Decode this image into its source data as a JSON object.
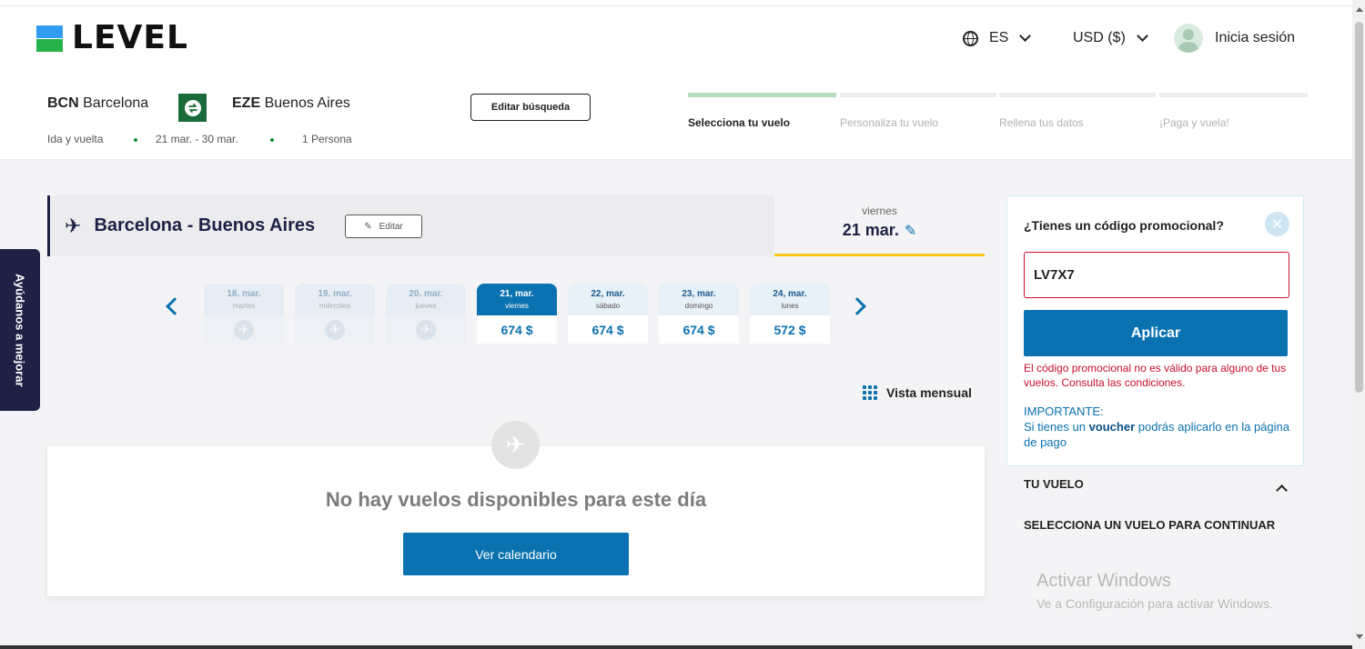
{
  "header": {
    "logo_text": "LEVEL",
    "language": "ES",
    "currency": "USD ($)",
    "login": "Inicia sesión"
  },
  "search": {
    "origin_code": "BCN",
    "origin_city": "Barcelona",
    "destination_code": "EZE",
    "destination_city": "Buenos Aires",
    "trip_type": "Ida y vuelta",
    "dates": "21 mar. - 30 mar.",
    "passengers": "1 Persona",
    "edit_label": "Editar búsqueda"
  },
  "steps": [
    {
      "label": "Selecciona tu vuelo",
      "active": true
    },
    {
      "label": "Personaliza tu vuelo",
      "active": false
    },
    {
      "label": "Rellena tus datos",
      "active": false
    },
    {
      "label": "¡Paga y vuela!",
      "active": false
    }
  ],
  "feedback_tab": "Ayúdanos a mejorar",
  "flight": {
    "title": "Barcelona - Buenos Aires",
    "edit": "Editar",
    "selected_weekday": "viernes",
    "selected_date": "21 mar."
  },
  "days": [
    {
      "date": "18. mar.",
      "weekday": "martes",
      "price": "",
      "state": "disabled"
    },
    {
      "date": "19. mar.",
      "weekday": "miércoles",
      "price": "",
      "state": "disabled"
    },
    {
      "date": "20. mar.",
      "weekday": "jueves",
      "price": "",
      "state": "disabled"
    },
    {
      "date": "21, mar.",
      "weekday": "viernes",
      "price": "674 $",
      "state": "active"
    },
    {
      "date": "22, mar.",
      "weekday": "sábado",
      "price": "674 $",
      "state": "normal"
    },
    {
      "date": "23, mar.",
      "weekday": "domingo",
      "price": "674 $",
      "state": "normal"
    },
    {
      "date": "24, mar.",
      "weekday": "lunes",
      "price": "572 $",
      "state": "normal"
    }
  ],
  "monthly_view": "Vista mensual",
  "no_flights": {
    "message": "No hay vuelos disponibles para este día",
    "button": "Ver calendario"
  },
  "promo": {
    "title": "¿Tienes un código promocional?",
    "code": "LV7X7",
    "apply": "Aplicar",
    "error": "El código promocional no es válido para alguno de tus vuelos. Consulta las condiciones.",
    "important_label": "IMPORTANTE:",
    "important_pre": "Si tienes un",
    "important_bold": "voucher",
    "important_post": "podrás aplicarlo en la página de pago"
  },
  "your_flight": {
    "title": "TU VUELO",
    "select_msg": "SELECCIONA UN VUELO PARA CONTINUAR"
  },
  "windows_watermark": {
    "line1": "Activar Windows",
    "line2": "Ve a Configuración para activar Windows."
  },
  "colors": {
    "primary": "#0a72b0",
    "navy": "#1e2145",
    "error": "#c8102e",
    "accent_yellow": "#f5c518",
    "step_active": "#b6dcbe"
  }
}
